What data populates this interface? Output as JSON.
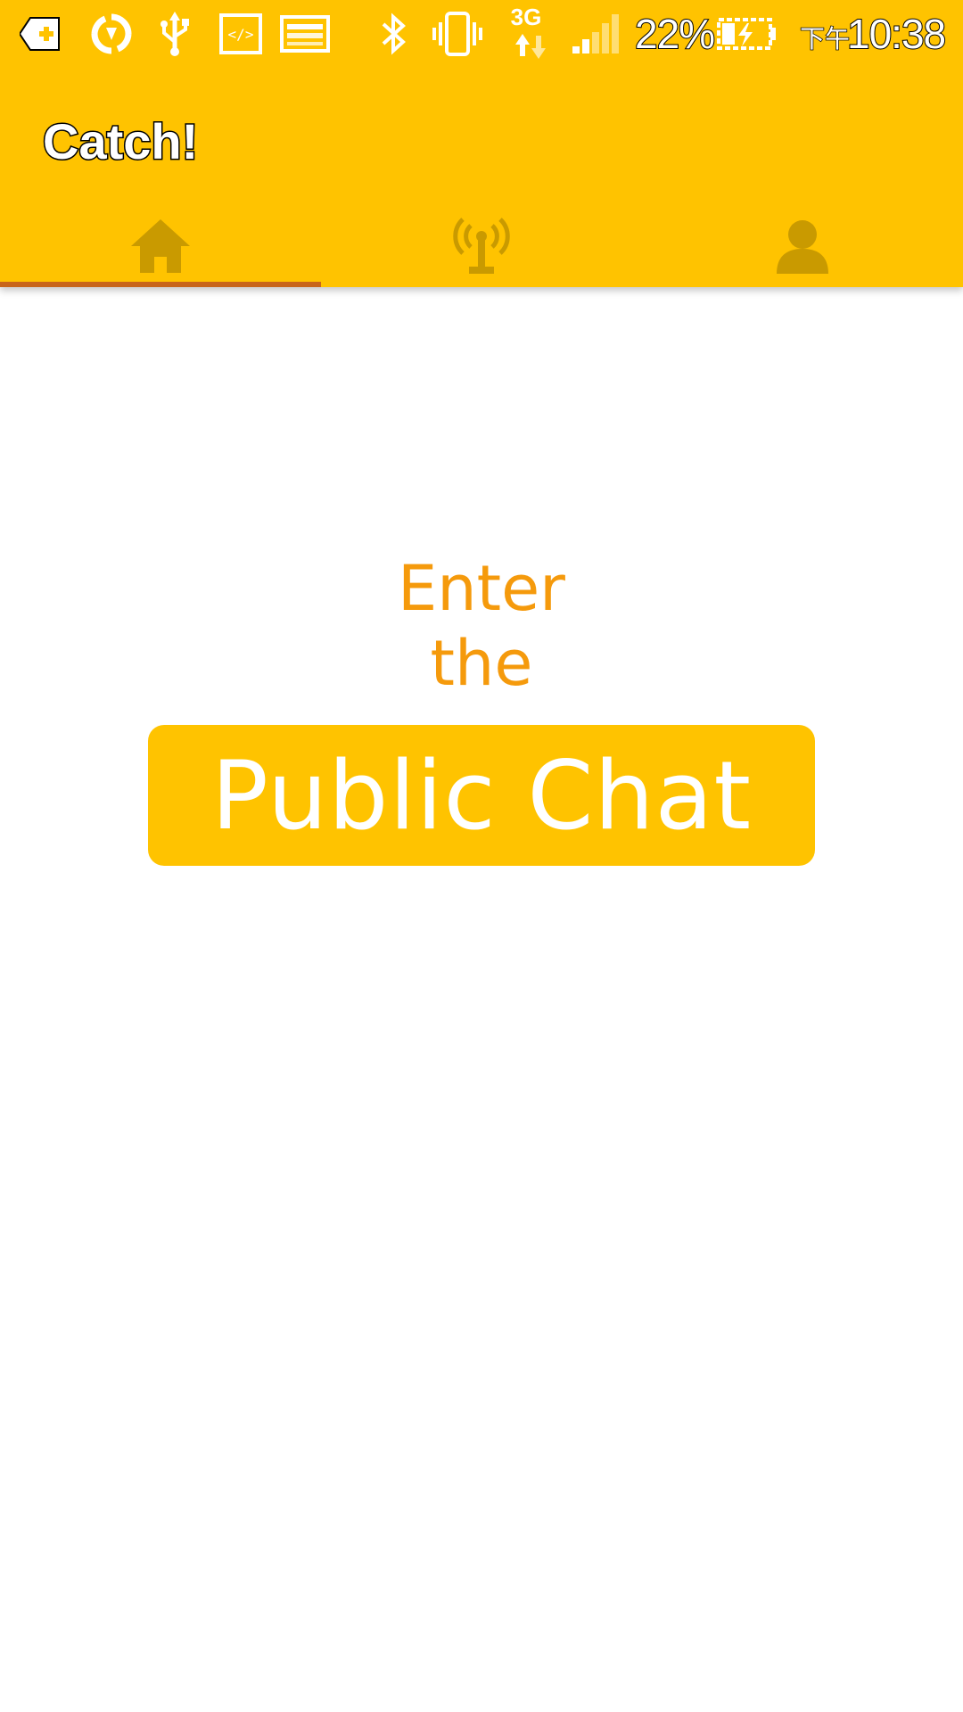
{
  "status_bar": {
    "battery_percent": "22%",
    "time_prefix": "下午",
    "time": "10:38",
    "network_type": "3G",
    "signal_bars_filled": 2,
    "signal_bars_total": 5,
    "icons": [
      "notification-add-icon",
      "sync-icon",
      "usb-icon",
      "developer-code-icon",
      "screenshot-icon",
      "bluetooth-icon",
      "vibrate-icon",
      "network-3g-icon",
      "signal-icon",
      "battery-charging-icon"
    ]
  },
  "app_bar": {
    "title": "Catch!"
  },
  "tabs": [
    {
      "icon": "home-icon",
      "selected": true
    },
    {
      "icon": "broadcast-tower-icon",
      "selected": false
    },
    {
      "icon": "profile-icon",
      "selected": false
    }
  ],
  "main": {
    "line1": "Enter",
    "line2": "the",
    "button_label": "Public Chat"
  },
  "colors": {
    "primary": "#FFC300",
    "accent_text": "#F59A0C",
    "tab_indicator": "#C8651A",
    "tab_icon": "#C99A00",
    "background": "#FFFFFF"
  }
}
